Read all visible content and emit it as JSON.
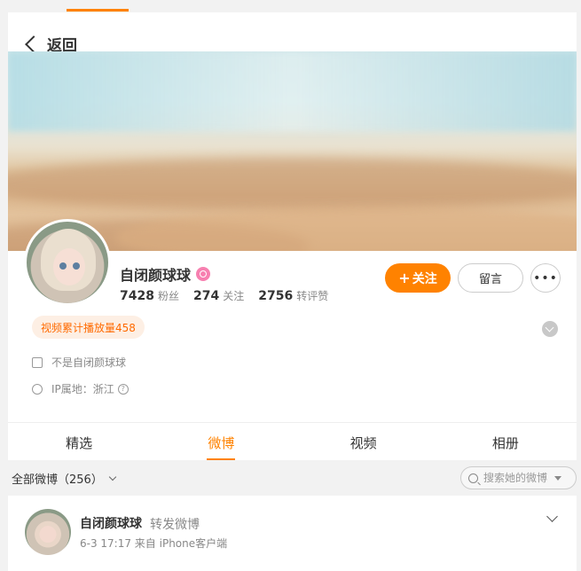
{
  "header": {
    "back_label": "返回"
  },
  "profile": {
    "name": "自闭颜球球",
    "stats": [
      {
        "value": "7428",
        "unit": "粉丝"
      },
      {
        "value": "274",
        "unit": "关注"
      },
      {
        "value": "2756",
        "unit": "转评赞"
      }
    ],
    "follow_label": "关注",
    "message_label": "留言",
    "views_badge": "视频累计播放量458",
    "bio": "不是自闭颜球球",
    "ip_location": "IP属地：浙江"
  },
  "tabs": [
    {
      "label": "精选",
      "active": false
    },
    {
      "label": "微博",
      "active": true
    },
    {
      "label": "视频",
      "active": false
    },
    {
      "label": "相册",
      "active": false
    }
  ],
  "feed": {
    "filter_label": "全部微博（256）",
    "search_placeholder": "搜索她的微博"
  },
  "post": {
    "author": "自闭颜球球",
    "action": "转发微博",
    "meta": "6-3 17:17  来自 iPhone客户端"
  },
  "colors": {
    "accent": "#ff8200",
    "badge_bg": "#fdefe4",
    "badge_text": "#ff6a00",
    "verify_badge": "#f780b0"
  }
}
